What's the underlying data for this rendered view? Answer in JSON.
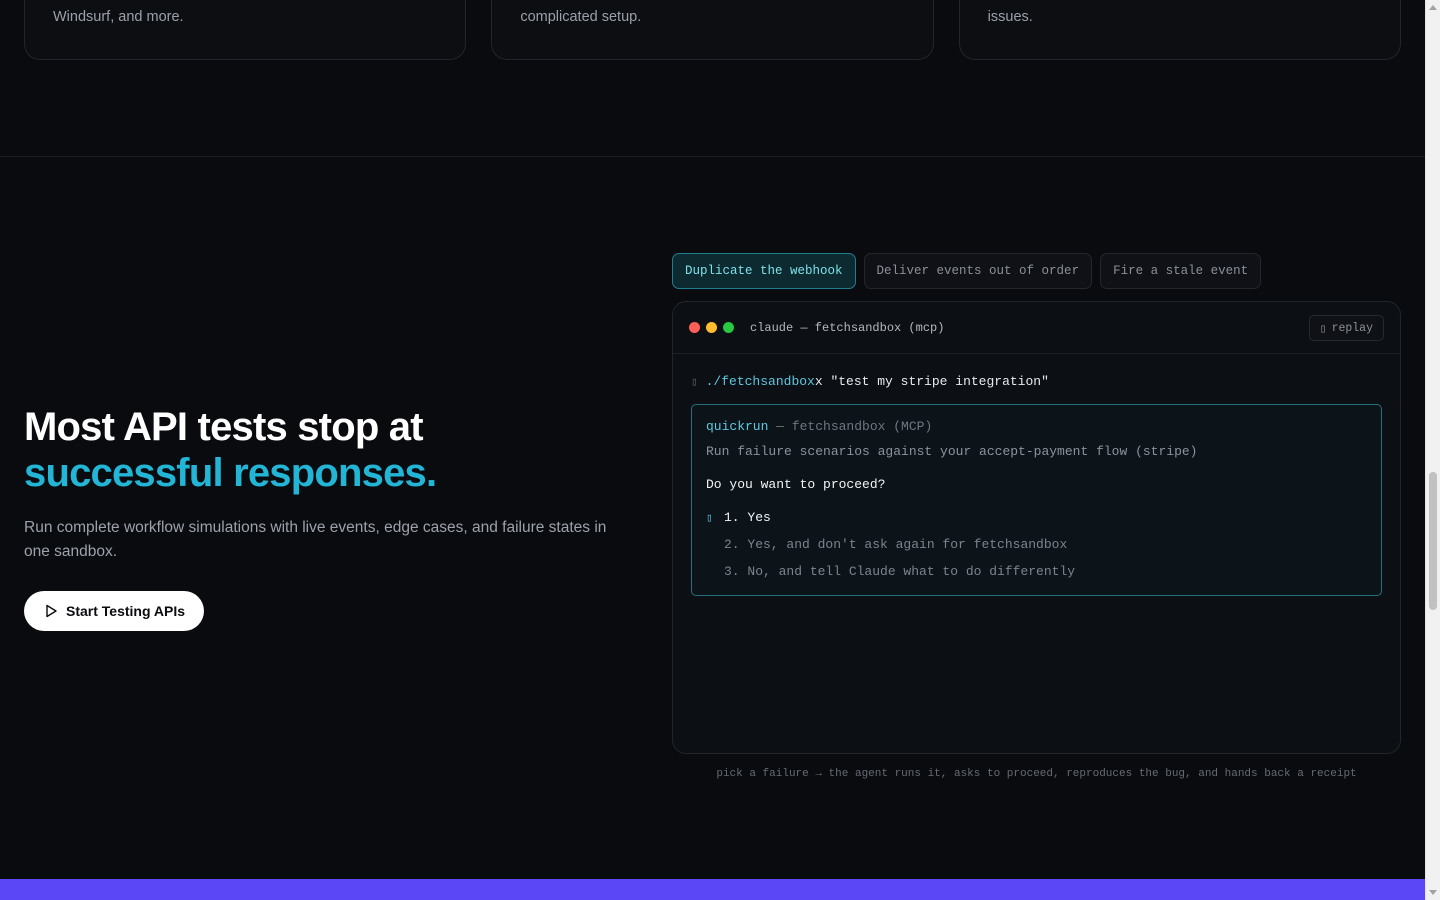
{
  "features": [
    {
      "text": "minutes. Works with Cursor, VS Code, Claude Code, Windsurf, and more."
    },
    {
      "text": "requests, and async events. No mock servers. No complicated setup."
    },
    {
      "text": "and verified workflows. Ship faster with fewer production issues."
    }
  ],
  "hero": {
    "title_line1": "Most API tests stop at",
    "title_line2": "successful responses.",
    "subtitle": "Run complete workflow simulations with live events, edge cases, and failure states in one sandbox.",
    "cta_label": "Start Testing APIs",
    "accent_color": "#22b5d6"
  },
  "tabs": [
    {
      "label": "Duplicate the webhook",
      "active": true
    },
    {
      "label": "Deliver events out of order",
      "active": false
    },
    {
      "label": "Fire a stale event",
      "active": false
    }
  ],
  "terminal": {
    "title": "claude — fetchsandbox (mcp)",
    "replay_label": "replay",
    "replay_glyph": "▯",
    "prompt_glyph": "▯",
    "command_path": "./fetchsandbox",
    "command_rest": "x \"test my stripe integration\"",
    "dialog": {
      "tool_name": "quickrun",
      "tool_source": " — fetchsandbox (MCP)",
      "description": "Run failure scenarios against your accept-payment flow (stripe)",
      "question": "Do you want to proceed?",
      "selector_glyph": "▯",
      "options": [
        "1. Yes",
        "2. Yes, and don't ask again for fetchsandbox",
        "3. No, and tell Claude what to do differently"
      ]
    }
  },
  "caption": "pick a failure → the agent runs it, asks to proceed, reproduces the bug, and hands back a receipt",
  "colors": {
    "window_red": "#ff5f57",
    "window_yellow": "#febc2e",
    "window_green": "#28c840",
    "band": "#5b47f5"
  }
}
